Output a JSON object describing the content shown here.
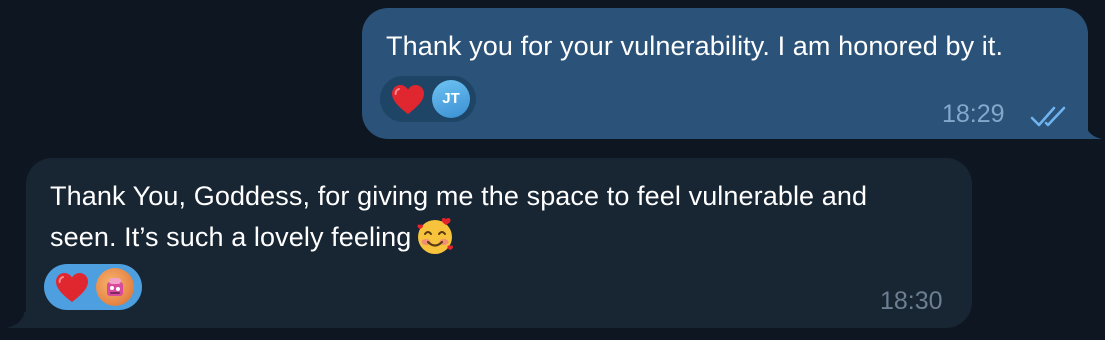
{
  "chat": {
    "messages": [
      {
        "direction": "outgoing",
        "text": "Thank you for your vulnerability. I am honored by it.",
        "reactions": [
          {
            "icon": "red-heart",
            "by": "JT"
          }
        ],
        "time": "18:29",
        "status_icon": "double-check-read"
      },
      {
        "direction": "incoming",
        "text_line1": "Thank You, Goddess, for giving me the space to feel vulnerable and",
        "text_line2": "seen. It’s such a lovely feeling",
        "inline_emoji": "smiling-face-with-hearts",
        "reactions": [
          {
            "icon": "red-heart",
            "by": "avatar"
          }
        ],
        "time": "18:30"
      }
    ]
  },
  "colors": {
    "background": "#0e1621",
    "outgoing_bubble": "#2b5278",
    "incoming_bubble": "#182533",
    "incoming_reaction_pill": "#4d9fe0",
    "read_check": "#6fb3ef"
  }
}
